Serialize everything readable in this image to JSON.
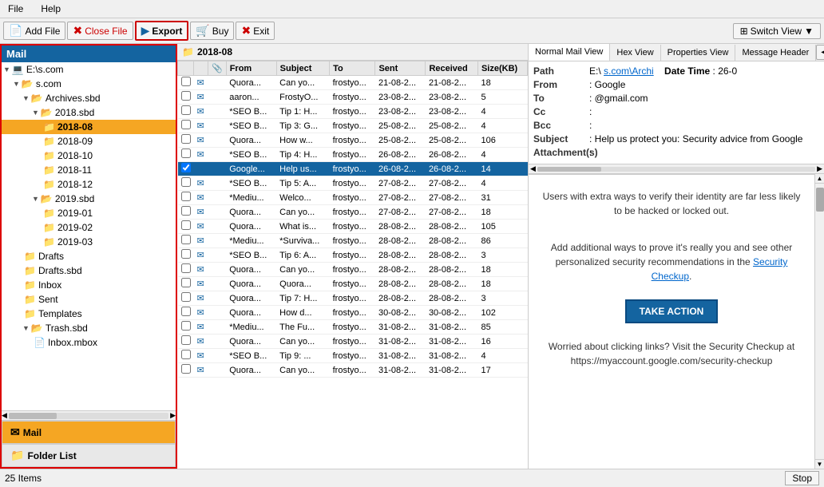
{
  "menu": {
    "file": "File",
    "help": "Help"
  },
  "toolbar": {
    "add_file": "Add File",
    "close_file": "Close File",
    "export": "Export",
    "buy": "Buy",
    "exit": "Exit",
    "switch_view": "Switch View"
  },
  "left_panel": {
    "title": "Mail",
    "tree": [
      {
        "id": "e_root",
        "label": "E:\\",
        "suffix": "s.com",
        "indent": 0,
        "type": "drive",
        "expanded": true
      },
      {
        "id": "sub1",
        "label": "",
        "suffix": "s.com",
        "indent": 1,
        "type": "folder",
        "expanded": true
      },
      {
        "id": "archives",
        "label": "Archives.sbd",
        "indent": 2,
        "type": "folder",
        "expanded": true
      },
      {
        "id": "2018sbd",
        "label": "2018.sbd",
        "indent": 3,
        "type": "folder",
        "expanded": true
      },
      {
        "id": "2018-08",
        "label": "2018-08",
        "indent": 4,
        "type": "folder",
        "selected": true
      },
      {
        "id": "2018-09",
        "label": "2018-09",
        "indent": 4,
        "type": "folder"
      },
      {
        "id": "2018-10",
        "label": "2018-10",
        "indent": 4,
        "type": "folder"
      },
      {
        "id": "2018-11",
        "label": "2018-11",
        "indent": 4,
        "type": "folder"
      },
      {
        "id": "2018-12",
        "label": "2018-12",
        "indent": 4,
        "type": "folder"
      },
      {
        "id": "2019sbd",
        "label": "2019.sbd",
        "indent": 3,
        "type": "folder",
        "expanded": true
      },
      {
        "id": "2019-01",
        "label": "2019-01",
        "indent": 4,
        "type": "folder"
      },
      {
        "id": "2019-02",
        "label": "2019-02",
        "indent": 4,
        "type": "folder"
      },
      {
        "id": "2019-03",
        "label": "2019-03",
        "indent": 4,
        "type": "folder"
      },
      {
        "id": "drafts",
        "label": "Drafts",
        "indent": 2,
        "type": "folder"
      },
      {
        "id": "draftssbd",
        "label": "Drafts.sbd",
        "indent": 2,
        "type": "folder"
      },
      {
        "id": "inbox",
        "label": "Inbox",
        "indent": 2,
        "type": "folder"
      },
      {
        "id": "sent",
        "label": "Sent",
        "indent": 2,
        "type": "folder"
      },
      {
        "id": "templates",
        "label": "Templates",
        "indent": 2,
        "type": "folder"
      },
      {
        "id": "trashsbd",
        "label": "Trash.sbd",
        "indent": 2,
        "type": "folder",
        "expanded": true
      },
      {
        "id": "inbox_mbox",
        "label": "Inbox.mbox",
        "indent": 3,
        "type": "file"
      }
    ],
    "tab_mail": "Mail",
    "tab_folder": "Folder List"
  },
  "folder_title": "2018-08",
  "email_table": {
    "columns": [
      "",
      "",
      "",
      "From",
      "Subject",
      "To",
      "Sent",
      "Received",
      "Size(KB)"
    ],
    "rows": [
      {
        "from": "Quora...",
        "subject": "Can yo...",
        "to": "frostyo...",
        "sent": "21-08-2...",
        "received": "21-08-2...",
        "size": "18",
        "has_attachment": false
      },
      {
        "from": "aaron...",
        "subject": "FrostyO...",
        "to": "frostyo...",
        "sent": "23-08-2...",
        "received": "23-08-2...",
        "size": "5",
        "has_attachment": false
      },
      {
        "from": "*SEO B...",
        "subject": "Tip 1: H...",
        "to": "frostyo...",
        "sent": "23-08-2...",
        "received": "23-08-2...",
        "size": "4",
        "has_attachment": false
      },
      {
        "from": "*SEO B...",
        "subject": "Tip 3: G...",
        "to": "frostyo...",
        "sent": "25-08-2...",
        "received": "25-08-2...",
        "size": "4",
        "has_attachment": false
      },
      {
        "from": "Quora...",
        "subject": "How w...",
        "to": "frostyo...",
        "sent": "25-08-2...",
        "received": "25-08-2...",
        "size": "106",
        "has_attachment": false
      },
      {
        "from": "*SEO B...",
        "subject": "Tip 4: H...",
        "to": "frostyo...",
        "sent": "26-08-2...",
        "received": "26-08-2...",
        "size": "4",
        "has_attachment": false
      },
      {
        "from": "Google...",
        "subject": "Help us...",
        "to": "frostyo...",
        "sent": "26-08-2...",
        "received": "26-08-2...",
        "size": "14",
        "has_attachment": false,
        "selected": true
      },
      {
        "from": "*SEO B...",
        "subject": "Tip 5: A...",
        "to": "frostyo...",
        "sent": "27-08-2...",
        "received": "27-08-2...",
        "size": "4",
        "has_attachment": false
      },
      {
        "from": "*Mediu...",
        "subject": "Welco...",
        "to": "frostyo...",
        "sent": "27-08-2...",
        "received": "27-08-2...",
        "size": "31",
        "has_attachment": false
      },
      {
        "from": "Quora...",
        "subject": "Can yo...",
        "to": "frostyo...",
        "sent": "27-08-2...",
        "received": "27-08-2...",
        "size": "18",
        "has_attachment": false
      },
      {
        "from": "Quora...",
        "subject": "What is...",
        "to": "frostyo...",
        "sent": "28-08-2...",
        "received": "28-08-2...",
        "size": "105",
        "has_attachment": false
      },
      {
        "from": "*Mediu...",
        "subject": "*Surviva...",
        "to": "frostyo...",
        "sent": "28-08-2...",
        "received": "28-08-2...",
        "size": "86",
        "has_attachment": false
      },
      {
        "from": "*SEO B...",
        "subject": "Tip 6: A...",
        "to": "frostyo...",
        "sent": "28-08-2...",
        "received": "28-08-2...",
        "size": "3",
        "has_attachment": false
      },
      {
        "from": "Quora...",
        "subject": "Can yo...",
        "to": "frostyo...",
        "sent": "28-08-2...",
        "received": "28-08-2...",
        "size": "18",
        "has_attachment": false
      },
      {
        "from": "Quora...",
        "subject": "Quora...",
        "to": "frostyo...",
        "sent": "28-08-2...",
        "received": "28-08-2...",
        "size": "18",
        "has_attachment": false
      },
      {
        "from": "Quora...",
        "subject": "Tip 7: H...",
        "to": "frostyo...",
        "sent": "28-08-2...",
        "received": "28-08-2...",
        "size": "3",
        "has_attachment": false
      },
      {
        "from": "Quora...",
        "subject": "How d...",
        "to": "frostyo...",
        "sent": "30-08-2...",
        "received": "30-08-2...",
        "size": "102",
        "has_attachment": false
      },
      {
        "from": "*Mediu...",
        "subject": "The Fu...",
        "to": "frostyo...",
        "sent": "31-08-2...",
        "received": "31-08-2...",
        "size": "85",
        "has_attachment": false
      },
      {
        "from": "Quora...",
        "subject": "Can yo...",
        "to": "frostyo...",
        "sent": "31-08-2...",
        "received": "31-08-2...",
        "size": "16",
        "has_attachment": false
      },
      {
        "from": "*SEO B...",
        "subject": "Tip 9: ...",
        "to": "frostyo...",
        "sent": "31-08-2...",
        "received": "31-08-2...",
        "size": "4",
        "has_attachment": false
      },
      {
        "from": "Quora...",
        "subject": "Can yo...",
        "to": "frostyo...",
        "sent": "31-08-2...",
        "received": "31-08-2...",
        "size": "17",
        "has_attachment": false
      }
    ]
  },
  "right_panel": {
    "tabs": [
      "Normal Mail View",
      "Hex View",
      "Properties View",
      "Message Header"
    ],
    "active_tab": "Normal Mail View",
    "header": {
      "path_label": "Path",
      "path_value": "E:\\",
      "path_link": "s.com\\Archi",
      "datetime_label": "Date Time",
      "datetime_value": "26-0",
      "from_label": "From",
      "from_value": "Google",
      "to_label": "To",
      "to_value": "@gmail.com",
      "cc_label": "Cc",
      "cc_value": "",
      "bcc_label": "Bcc",
      "bcc_value": "",
      "subject_label": "Subject",
      "subject_value": "Help us protect you: Security advice from Google",
      "attachments_label": "Attachment(s)",
      "attachments_value": ""
    },
    "body_text1": "Users with extra ways to verify their identity are far less likely to be hacked or locked out.",
    "body_text2": "Add additional ways to prove it's really you and see other personalized security recommendations in the",
    "body_link": "Security Checkup",
    "body_text3": ".",
    "body_btn": "TAKE ACTION",
    "body_text4": "Worried about clicking links? Visit the Security Checkup at https://myaccount.google.com/security-checkup"
  },
  "status": {
    "items_count": "25 Items",
    "stop_btn": "Stop"
  }
}
